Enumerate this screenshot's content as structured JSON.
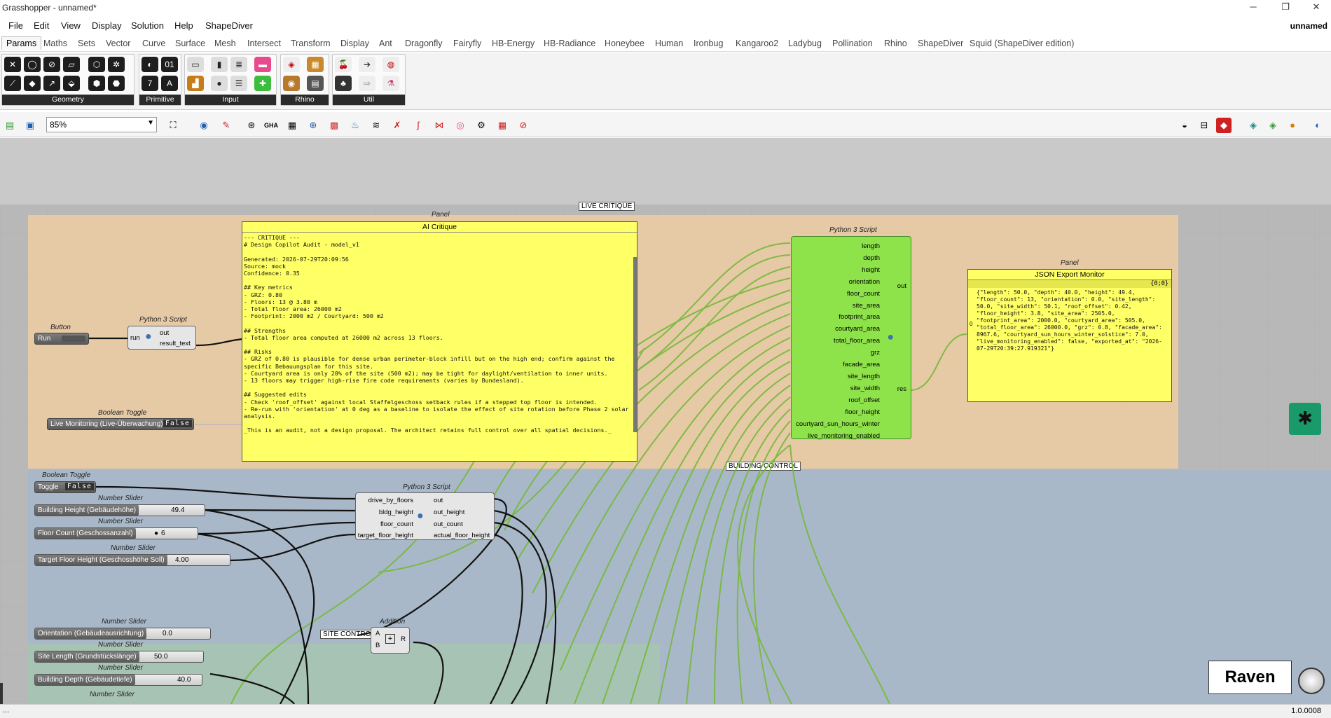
{
  "window": {
    "title": "Grasshopper - unnamed*",
    "minimize": "─",
    "maximize": "❐",
    "close": "✕"
  },
  "menu": {
    "items": [
      "File",
      "Edit",
      "View",
      "Display",
      "Solution",
      "Help",
      "ShapeDiver"
    ],
    "doc_name": "unnamed"
  },
  "tabs": [
    "Params",
    "Maths",
    "Sets",
    "Vector",
    "Curve",
    "Surface",
    "Mesh",
    "Intersect",
    "Transform",
    "Display",
    "Ant",
    "Dragonfly",
    "Fairyfly",
    "HB-Energy",
    "HB-Radiance",
    "Honeybee",
    "Human",
    "Ironbug",
    "Kangaroo2",
    "Ladybug",
    "Pollination",
    "Rhino",
    "ShapeDiver",
    "Squid (ShapeDiver edition)"
  ],
  "ribbon_groups": [
    {
      "name": "Geometry"
    },
    {
      "name": "Primitive"
    },
    {
      "name": "Input"
    },
    {
      "name": "Rhino"
    },
    {
      "name": "Util"
    }
  ],
  "toolbar": {
    "zoom": "85%"
  },
  "groups": {
    "live": {
      "tag": "LIVE CRITIQUE",
      "color": "#e8c9a3"
    },
    "building": {
      "tag": "BUILDING CONTROL",
      "color": "#a8b7c8"
    },
    "site": {
      "tag": "SITE CONTROL",
      "color": "#a6c4b0"
    }
  },
  "components": {
    "button": {
      "caption": "Button",
      "label": "Run"
    },
    "py_run": {
      "caption": "Python 3 Script",
      "in": "run",
      "out": [
        "out",
        "result_text"
      ]
    },
    "toggle_live": {
      "caption": "Boolean Toggle",
      "label": "Live Monitoring (Live-Überwachung)",
      "value": "False"
    },
    "critique": {
      "caption": "Panel",
      "title": "AI Critique",
      "text": "--- CRITIQUE ---\n# Design Copilot Audit - model_v1\n\nGenerated: 2026-07-29T20:09:56\nSource: mock\nConfidence: 0.35\n\n## Key metrics\n- GRZ: 0.80\n- Floors: 13 @ 3.80 m\n- Total floor area: 26000 m2\n- Footprint: 2000 m2 / Courtyard: 500 m2\n\n## Strengths\n- Total floor area computed at 26000 m2 across 13 floors.\n\n## Risks\n- GRZ of 0.80 is plausible for dense urban perimeter-block infill but on the high end; confirm against the specific Bebauungsplan for this site.\n- Courtyard area is only 20% of the site (500 m2); may be tight for daylight/ventilation to inner units.\n- 13 floors may trigger high-rise fire code requirements (varies by Bundesland).\n\n## Suggested edits\n- Check 'roof_offset' against local Staffelgeschoss setback rules if a stepped top floor is intended.\n- Re-run with 'orientation' at 0 deg as a baseline to isolate the effect of site rotation before Phase 2 solar analysis.\n\n_This is an audit, not a design proposal. The architect retains full control over all spatial decisions._"
    },
    "py_big": {
      "caption": "Python 3 Script",
      "inputs": [
        "length",
        "depth",
        "height",
        "orientation",
        "floor_count",
        "site_area",
        "footprint_area",
        "courtyard_area",
        "total_floor_area",
        "grz",
        "facade_area",
        "site_length",
        "site_width",
        "roof_offset",
        "floor_height",
        "courtyard_sun_hours_winter",
        "live_monitoring_enabled"
      ],
      "out": "out",
      "res": "res"
    },
    "json_panel": {
      "caption": "Panel",
      "title": "JSON Export Monitor",
      "index": "{0;0}",
      "row": "0",
      "text": "{\"length\": 50.0, \"depth\": 40.0, \"height\": 49.4, \"floor_count\": 13, \"orientation\": 0.0, \"site_length\": 50.0, \"site_width\": 50.1, \"roof_offset\": 0.42, \"floor_height\": 3.8, \"site_area\": 2505.0, \"footprint_area\": 2000.0, \"courtyard_area\": 505.0, \"total_floor_area\": 26000.0, \"grz\": 0.8, \"facade_area\": 8967.6, \"courtyard_sun_hours_winter_solstice\": 7.0, \"live_monitoring_enabled\": false, \"exported_at\": \"2026-07-29T20:39:27.919321\"}"
    },
    "toggle_bld": {
      "caption": "Boolean Toggle",
      "label": "Toggle",
      "value": "False"
    },
    "sl_height": {
      "caption": "Number Slider",
      "label": "Building Height (Gebäudehöhe)",
      "value": "49.4"
    },
    "sl_floors": {
      "caption": "Number Slider",
      "label": "Floor Count (Geschossanzahl)",
      "value": "6"
    },
    "sl_tfh": {
      "caption": "Number Slider",
      "label": "Target Floor Height (Geschosshöhe Soll)",
      "value": "4.00"
    },
    "py_bld": {
      "caption": "Python 3 Script",
      "in": [
        "drive_by_floors",
        "bldg_height",
        "floor_count",
        "target_floor_height"
      ],
      "out": [
        "out",
        "out_height",
        "out_count",
        "actual_floor_height"
      ]
    },
    "sl_orient": {
      "caption": "Number Slider",
      "label": "Orientation (Gebäudeausrichtung)",
      "value": "0.0"
    },
    "sl_sitelen": {
      "caption": "Number Slider",
      "label": "Site Length (Grundstückslänge)",
      "value": "50.0"
    },
    "sl_depth": {
      "caption": "Number Slider",
      "label": "Building Depth (Gebäudetiefe)",
      "value": "40.0"
    },
    "sl_next": {
      "caption": "Number Slider"
    },
    "addition": {
      "caption": "Addition",
      "a": "A",
      "b": "B",
      "r": "R",
      "op": "+"
    }
  },
  "raven": "Raven",
  "status": {
    "version": "1.0.0008"
  }
}
